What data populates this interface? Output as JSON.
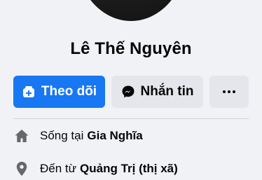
{
  "profile": {
    "name": "Lê Thế Nguyên"
  },
  "actions": {
    "follow_label": "Theo dõi",
    "message_label": "Nhắn tin"
  },
  "info": {
    "lives_prefix": "Sống tại",
    "lives_place": "Gia Nghĩa",
    "from_prefix": "Đến từ",
    "from_place": "Quảng Trị (thị xã)"
  },
  "icons": {
    "follow": "add-friend-icon",
    "message": "messenger-icon",
    "more": "more-dots-icon",
    "home": "home-icon",
    "location": "location-pin-icon"
  },
  "colors": {
    "primary": "#1877f2",
    "secondary": "#e4e6eb",
    "background": "#f0f2f5",
    "icon": "#65676b"
  }
}
